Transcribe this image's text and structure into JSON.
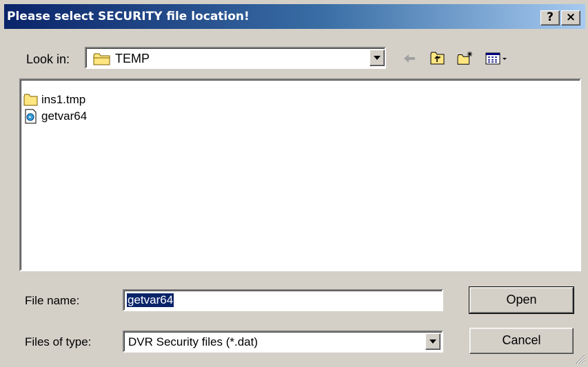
{
  "window": {
    "title": "Please select SECURITY file location!",
    "help_button": "?",
    "close_button": "×"
  },
  "lookin": {
    "label": "Look in:",
    "value": "TEMP",
    "icon": "folder-icon"
  },
  "toolbar": {
    "back_icon": "back-arrow-icon",
    "up_icon": "up-one-level-icon",
    "new_folder_icon": "new-folder-icon",
    "view_icon": "view-menu-icon"
  },
  "files": [
    {
      "name": "ins1.tmp",
      "icon": "folder-icon"
    },
    {
      "name": "getvar64",
      "icon": "file-icon"
    }
  ],
  "filename": {
    "label": "File name:",
    "value": "getvar64"
  },
  "filetype": {
    "label": "Files of type:",
    "value": "DVR Security files (*.dat)"
  },
  "buttons": {
    "open": "Open",
    "cancel": "Cancel"
  },
  "colors": {
    "title_start": "#0a246a",
    "title_end": "#a6caf0",
    "face": "#d4d0c8",
    "selection": "#0a246a"
  }
}
